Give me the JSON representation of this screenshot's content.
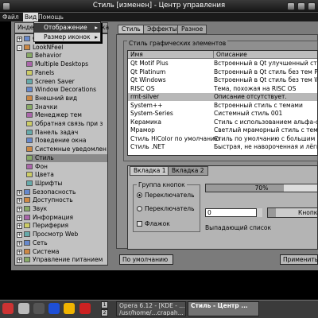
{
  "window": {
    "title": "Стиль [изменен] - Центр управления"
  },
  "menubar": {
    "items": [
      "Файл",
      "Вид",
      "Помощь"
    ]
  },
  "view_menu": {
    "items": [
      "Отображение",
      "Размер иконок"
    ]
  },
  "sidebar": {
    "tabs": [
      "Инде",
      "Справка"
    ],
    "tree": [
      {
        "label": "Система",
        "level": 0,
        "expander": "+"
      },
      {
        "label": "LookNFeel",
        "level": 0,
        "expander": "-"
      },
      {
        "label": "Behavior",
        "level": 1
      },
      {
        "label": "Multiple Desktops",
        "level": 1
      },
      {
        "label": "Panels",
        "level": 1
      },
      {
        "label": "Screen Saver",
        "level": 1
      },
      {
        "label": "Window Decorations",
        "level": 1
      },
      {
        "label": "Внешний вид",
        "level": 1
      },
      {
        "label": "Значки",
        "level": 1
      },
      {
        "label": "Менеджер тем",
        "level": 1
      },
      {
        "label": "Обратная связь при з",
        "level": 1
      },
      {
        "label": "Панель задач",
        "level": 1
      },
      {
        "label": "Поведение окна",
        "level": 1
      },
      {
        "label": "Системные уведомлен",
        "level": 1
      },
      {
        "label": "Стиль",
        "level": 1,
        "selected": true
      },
      {
        "label": "Фон",
        "level": 1
      },
      {
        "label": "Цвета",
        "level": 1
      },
      {
        "label": "Шрифты",
        "level": 1
      },
      {
        "label": "Безопасность",
        "level": 0,
        "expander": "+"
      },
      {
        "label": "Доступность",
        "level": 0,
        "expander": "+"
      },
      {
        "label": "Звук",
        "level": 0,
        "expander": "+"
      },
      {
        "label": "Информация",
        "level": 0,
        "expander": "+"
      },
      {
        "label": "Периферия",
        "level": 0,
        "expander": "+"
      },
      {
        "label": "Просмотр Web",
        "level": 0,
        "expander": "+"
      },
      {
        "label": "Сеть",
        "level": 0,
        "expander": "+"
      },
      {
        "label": "Система",
        "level": 0,
        "expander": "+"
      },
      {
        "label": "Управление питанием",
        "level": 0,
        "expander": "+"
      }
    ]
  },
  "main_tabs": [
    "Стиль",
    "Эффекты",
    "Разное"
  ],
  "widget_style": {
    "group_label": "Стиль графических элементов",
    "columns": [
      "Имя",
      "Описание"
    ],
    "rows": [
      {
        "name": "Qt Motif Plus",
        "desc": "Встроенный в Qt улучшенный стиль"
      },
      {
        "name": "Qt Platinum",
        "desc": "Встроенный в Qt стиль без тем Platinum"
      },
      {
        "name": "Qt Windows",
        "desc": "Встроенный в Qt стиль без тем Windows"
      },
      {
        "name": "RISC OS",
        "desc": "Тема, похожая на RISC OS"
      },
      {
        "name": "rmt-silver",
        "desc": "Описание отсутствует.",
        "selected": true
      },
      {
        "name": "System++",
        "desc": "Встроенный стиль с темами"
      },
      {
        "name": "System-Series",
        "desc": "Системный стиль 001"
      },
      {
        "name": "Керамика",
        "desc": "Стиль с использованием альфа-сме"
      },
      {
        "name": "Мрамор",
        "desc": "Светлый мраморный стиль с темами"
      },
      {
        "name": "Стиль HiColor по умолчанию",
        "desc": "Стиль по умолчанию с большим кол"
      },
      {
        "name": "Стиль .NET",
        "desc": "Быстрая, не навороченная и лёгкая"
      }
    ]
  },
  "preview": {
    "tabs": [
      "Вкладка 1",
      "Вкладка 2"
    ],
    "button_group_label": "Группа кнопок",
    "radio1": "Переключатель",
    "radio2": "Переключатель",
    "checkbox_label": "Флажок",
    "progress_text": "70%",
    "progress_value": 70,
    "spin_value": "0",
    "combo_button": "Кнопка",
    "dropdown_label": "Выпадающий список"
  },
  "buttons": {
    "defaults": "По умолчанию",
    "apply": "Применить"
  },
  "taskbar": {
    "pager": [
      "1",
      "2"
    ],
    "tasks": [
      "Opera 6.12 - [KDE - ...]",
      "Стиль - Центр ..."
    ],
    "task_subtitle": "/usr/home/...crapah..."
  }
}
